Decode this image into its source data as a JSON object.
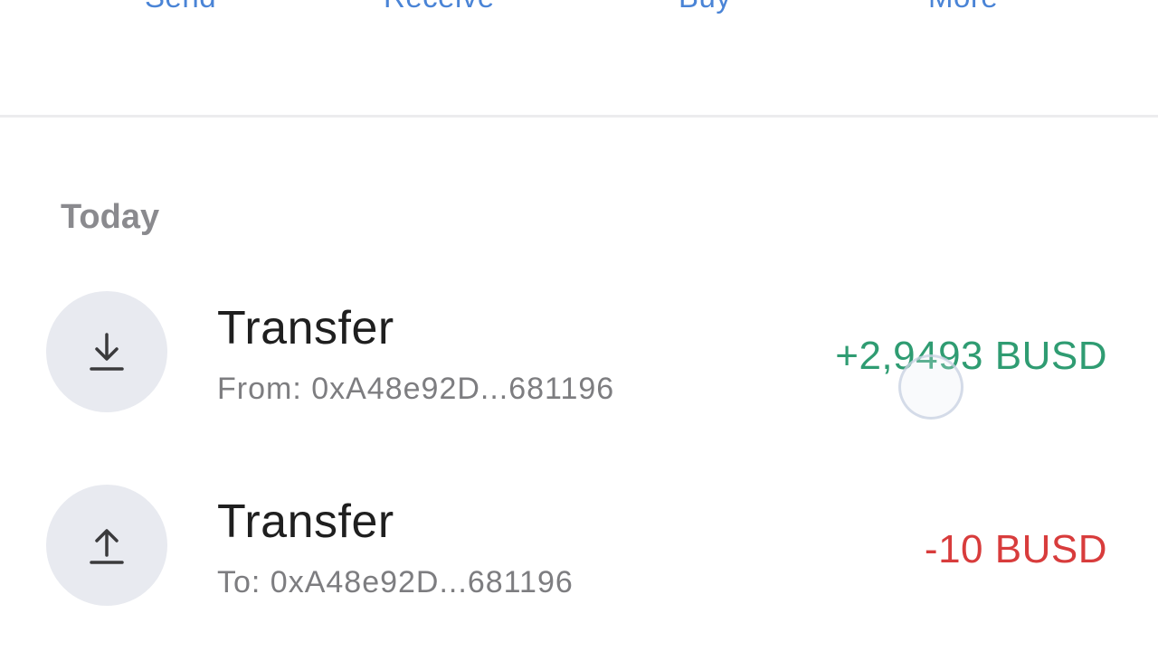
{
  "actions": {
    "send": "Send",
    "receive": "Receive",
    "buy": "Buy",
    "more": "More"
  },
  "history": {
    "section_title": "Today",
    "transactions": [
      {
        "title": "Transfer",
        "subtitle": "From: 0xA48e92D...681196",
        "amount": "+2,9493 BUSD",
        "direction": "incoming",
        "icon": "download-arrow-icon"
      },
      {
        "title": "Transfer",
        "subtitle": "To: 0xA48e92D...681196",
        "amount": "-10 BUSD",
        "direction": "outgoing",
        "icon": "upload-arrow-icon"
      }
    ]
  },
  "colors": {
    "accent": "#4a84d6",
    "incoming": "#2f9c72",
    "outgoing": "#d83c3c",
    "icon_bg": "#e8eaf0"
  }
}
